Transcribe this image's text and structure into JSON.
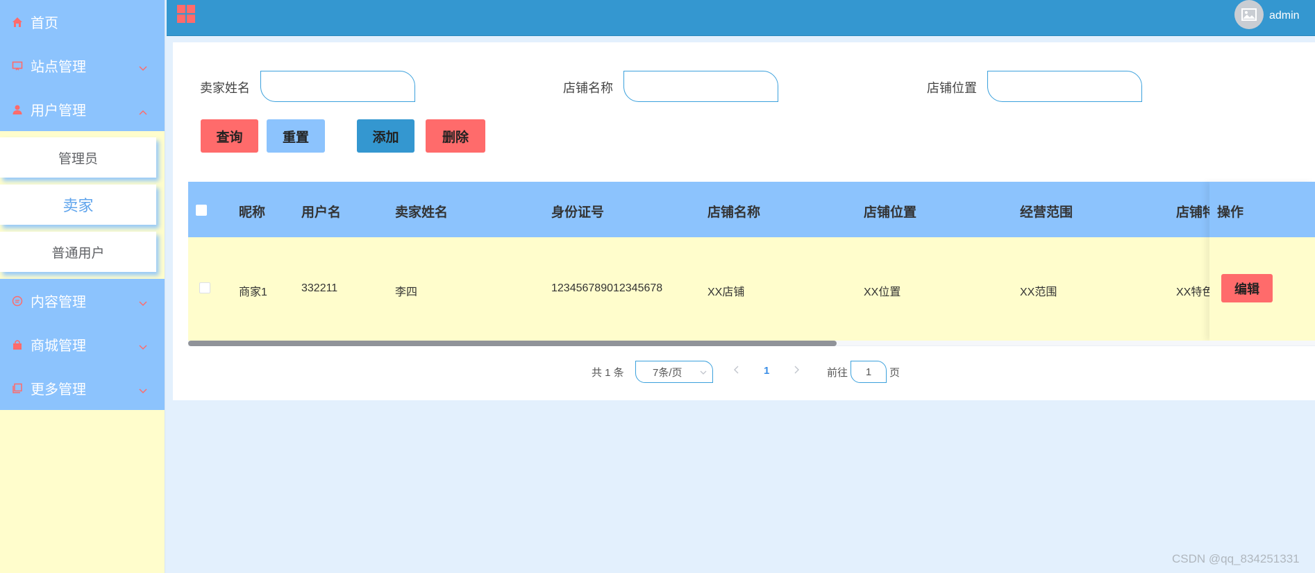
{
  "sidebar": {
    "items": [
      {
        "label": "首页",
        "icon": "home-icon",
        "expanded": null
      },
      {
        "label": "站点管理",
        "icon": "monitor-icon",
        "expanded": false
      },
      {
        "label": "用户管理",
        "icon": "user-icon",
        "expanded": true
      },
      {
        "label": "内容管理",
        "icon": "chat-icon",
        "expanded": false
      },
      {
        "label": "商城管理",
        "icon": "bag-icon",
        "expanded": false
      },
      {
        "label": "更多管理",
        "icon": "copy-icon",
        "expanded": false
      }
    ],
    "submenu": [
      {
        "label": "管理员",
        "active": false
      },
      {
        "label": "卖家",
        "active": true
      },
      {
        "label": "普通用户",
        "active": false
      }
    ]
  },
  "header": {
    "username": "admin",
    "grid_icon": "grid-menu-icon"
  },
  "search": {
    "fields": [
      {
        "label": "卖家姓名",
        "value": ""
      },
      {
        "label": "店铺名称",
        "value": ""
      },
      {
        "label": "店铺位置",
        "value": ""
      }
    ],
    "buttons": {
      "query": "查询",
      "reset": "重置",
      "add": "添加",
      "delete": "删除"
    }
  },
  "table": {
    "columns": [
      "昵称",
      "用户名",
      "卖家姓名",
      "身份证号",
      "店铺名称",
      "店铺位置",
      "经营范围",
      "店铺特",
      "操作"
    ],
    "rows": [
      {
        "nickname": "商家1",
        "username": "332211",
        "seller_name": "李四",
        "id_number": "123456789012345678",
        "shop_name": "XX店铺",
        "shop_location": "XX位置",
        "business_scope": "XX范围",
        "shop_feature": "XX特色",
        "action": "编辑"
      }
    ]
  },
  "pagination": {
    "total_text": "共 1 条",
    "page_size": "7条/页",
    "current_page": "1",
    "goto_label": "前往",
    "goto_value": "1",
    "page_suffix": "页"
  },
  "colors": {
    "sidebar_bg": "#8cc3fd",
    "header_bg": "#3497d0",
    "accent_red": "#ff6b6b",
    "row_bg": "#fffdcc",
    "active_blue": "#5fa4ec"
  },
  "watermark": "CSDN @qq_834251331"
}
